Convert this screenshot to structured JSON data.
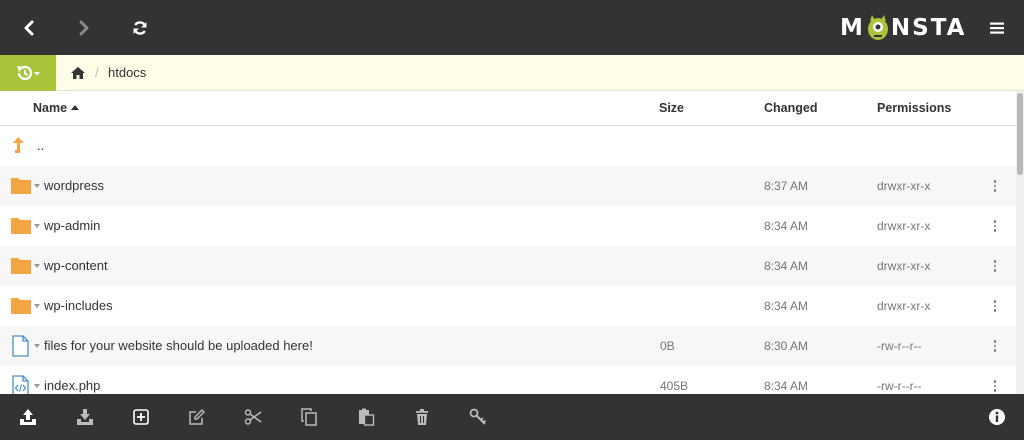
{
  "brand": {
    "name_left": "M",
    "name_right": "NSTA"
  },
  "breadcrumb": {
    "separator": "/",
    "current": "htdocs"
  },
  "columns": {
    "name": "Name",
    "size": "Size",
    "changed": "Changed",
    "permissions": "Permissions"
  },
  "parent_row": {
    "name": ".."
  },
  "files": [
    {
      "name": "wordpress",
      "type": "folder",
      "size": "",
      "changed": "8:37 AM",
      "permissions": "drwxr-xr-x"
    },
    {
      "name": "wp-admin",
      "type": "folder",
      "size": "",
      "changed": "8:34 AM",
      "permissions": "drwxr-xr-x"
    },
    {
      "name": "wp-content",
      "type": "folder",
      "size": "",
      "changed": "8:34 AM",
      "permissions": "drwxr-xr-x"
    },
    {
      "name": "wp-includes",
      "type": "folder",
      "size": "",
      "changed": "8:34 AM",
      "permissions": "drwxr-xr-x"
    },
    {
      "name": "files for your website should be uploaded here!",
      "type": "file",
      "size": "0B",
      "changed": "8:30 AM",
      "permissions": "-rw-r--r--"
    },
    {
      "name": "index.php",
      "type": "code-file",
      "size": "405B",
      "changed": "8:34 AM",
      "permissions": "-rw-r--r--"
    }
  ],
  "colors": {
    "topbar": "#333333",
    "history_accent": "#a8c43a",
    "folder": "#f2a541",
    "breadcrumb_bg": "#fdfde8",
    "file_icon": "#4a8fc7",
    "up_arrow": "#f2a541"
  },
  "icons": {
    "top": [
      "back-icon",
      "forward-icon",
      "refresh-icon",
      "hamburger-icon"
    ],
    "bottom": [
      "upload-icon",
      "download-icon",
      "new-item-icon",
      "edit-icon",
      "cut-icon",
      "copy-icon",
      "paste-icon",
      "delete-icon",
      "key-icon",
      "info-icon"
    ]
  }
}
